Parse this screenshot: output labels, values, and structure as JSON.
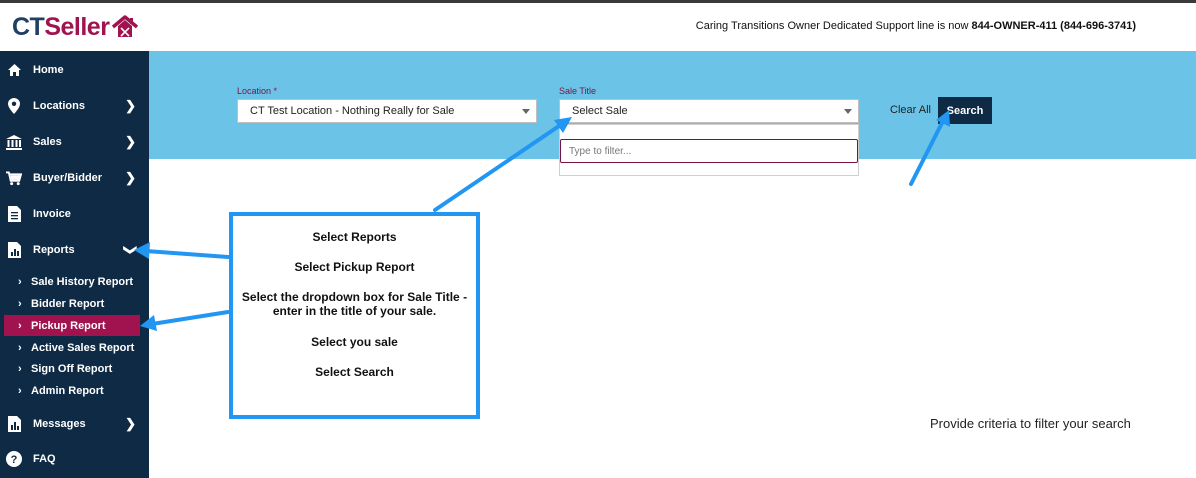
{
  "header": {
    "logo_ct": "CT",
    "logo_seller": "Seller",
    "support_prefix": "Caring Transitions Owner Dedicated Support line is now ",
    "support_number": "844-OWNER-411 (844-696-3741)"
  },
  "sidebar": {
    "items": [
      {
        "label": "Home",
        "icon": "home-icon"
      },
      {
        "label": "Locations",
        "icon": "map-pin-icon"
      },
      {
        "label": "Sales",
        "icon": "bank-icon"
      },
      {
        "label": "Buyer/Bidder",
        "icon": "cart-icon"
      },
      {
        "label": "Invoice",
        "icon": "document-icon"
      },
      {
        "label": "Reports",
        "icon": "report-icon"
      },
      {
        "label": "Messages",
        "icon": "chart-icon"
      },
      {
        "label": "FAQ",
        "icon": "question-icon"
      }
    ],
    "reports_sub": [
      {
        "label": "Sale History Report"
      },
      {
        "label": "Bidder Report"
      },
      {
        "label": "Pickup Report"
      },
      {
        "label": "Active Sales Report"
      },
      {
        "label": "Sign Off Report"
      },
      {
        "label": "Admin Report"
      }
    ]
  },
  "filters": {
    "location_label": "Location *",
    "location_value": "CT Test Location - Nothing Really for Sale",
    "sale_title_label": "Sale Title",
    "sale_title_value": "Select Sale",
    "filter_placeholder": "Type to filter...",
    "clear_all": "Clear All",
    "search": "Search"
  },
  "callout": {
    "line1": "Select Reports",
    "line2": "Select Pickup  Report",
    "line3a": "Select the dropdown box for Sale Title -",
    "line3b": "enter in the title of your sale.",
    "line4": "Select you sale",
    "line5": "Select Search"
  },
  "main": {
    "hint": "Provide criteria to filter your search"
  },
  "colors": {
    "sidebar_bg": "#0f2a44",
    "band_bg": "#6cc3e8",
    "active_item": "#a1134f",
    "arrow": "#2196f3",
    "label": "#7a1140"
  }
}
